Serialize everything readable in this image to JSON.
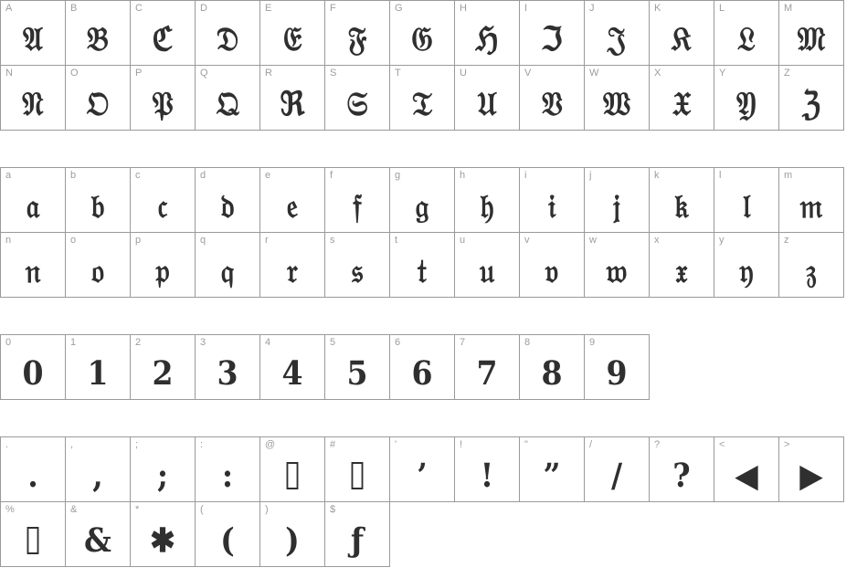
{
  "page": {
    "kind": "font-character-map-specimen",
    "background_color": "#ffffff",
    "cell_border_color": "#9a9a9a",
    "label_color": "#9d9d9d",
    "glyph_color": "#2f2f2f",
    "cell_size_px": 72
  },
  "sections": [
    {
      "id": "uppercase",
      "name": "uppercase-letters",
      "rows": [
        {
          "cells": [
            {
              "label": "A",
              "glyph": "𝔄",
              "missing": false
            },
            {
              "label": "B",
              "glyph": "𝔅",
              "missing": false
            },
            {
              "label": "C",
              "glyph": "ℭ",
              "missing": false
            },
            {
              "label": "D",
              "glyph": "𝔇",
              "missing": false
            },
            {
              "label": "E",
              "glyph": "𝔈",
              "missing": false
            },
            {
              "label": "F",
              "glyph": "𝔉",
              "missing": false
            },
            {
              "label": "G",
              "glyph": "𝔊",
              "missing": false
            },
            {
              "label": "H",
              "glyph": "ℌ",
              "missing": false
            },
            {
              "label": "I",
              "glyph": "ℑ",
              "missing": false
            },
            {
              "label": "J",
              "glyph": "𝔍",
              "missing": false
            },
            {
              "label": "K",
              "glyph": "𝔎",
              "missing": false
            },
            {
              "label": "L",
              "glyph": "𝔏",
              "missing": false
            },
            {
              "label": "M",
              "glyph": "𝔐",
              "missing": false
            }
          ]
        },
        {
          "cells": [
            {
              "label": "N",
              "glyph": "𝔑",
              "missing": false
            },
            {
              "label": "O",
              "glyph": "𝔒",
              "missing": false
            },
            {
              "label": "P",
              "glyph": "𝔓",
              "missing": false
            },
            {
              "label": "Q",
              "glyph": "𝔔",
              "missing": false
            },
            {
              "label": "R",
              "glyph": "ℜ",
              "missing": false
            },
            {
              "label": "S",
              "glyph": "𝔖",
              "missing": false
            },
            {
              "label": "T",
              "glyph": "𝔗",
              "missing": false
            },
            {
              "label": "U",
              "glyph": "𝔘",
              "missing": false
            },
            {
              "label": "V",
              "glyph": "𝔙",
              "missing": false
            },
            {
              "label": "W",
              "glyph": "𝔚",
              "missing": false
            },
            {
              "label": "X",
              "glyph": "𝔛",
              "missing": false
            },
            {
              "label": "Y",
              "glyph": "𝔜",
              "missing": false
            },
            {
              "label": "Z",
              "glyph": "ℨ",
              "missing": false
            }
          ]
        }
      ]
    },
    {
      "id": "lowercase",
      "name": "lowercase-letters",
      "rows": [
        {
          "cells": [
            {
              "label": "a",
              "glyph": "𝔞",
              "missing": false
            },
            {
              "label": "b",
              "glyph": "𝔟",
              "missing": false
            },
            {
              "label": "c",
              "glyph": "𝔠",
              "missing": false
            },
            {
              "label": "d",
              "glyph": "𝔡",
              "missing": false
            },
            {
              "label": "e",
              "glyph": "𝔢",
              "missing": false
            },
            {
              "label": "f",
              "glyph": "𝔣",
              "missing": false
            },
            {
              "label": "g",
              "glyph": "𝔤",
              "missing": false
            },
            {
              "label": "h",
              "glyph": "𝔥",
              "missing": false
            },
            {
              "label": "i",
              "glyph": "𝔦",
              "missing": false
            },
            {
              "label": "j",
              "glyph": "𝔧",
              "missing": false
            },
            {
              "label": "k",
              "glyph": "𝔨",
              "missing": false
            },
            {
              "label": "l",
              "glyph": "𝔩",
              "missing": false
            },
            {
              "label": "m",
              "glyph": "𝔪",
              "missing": false
            }
          ]
        },
        {
          "cells": [
            {
              "label": "n",
              "glyph": "𝔫",
              "missing": false
            },
            {
              "label": "o",
              "glyph": "𝔬",
              "missing": false
            },
            {
              "label": "p",
              "glyph": "𝔭",
              "missing": false
            },
            {
              "label": "q",
              "glyph": "𝔮",
              "missing": false
            },
            {
              "label": "r",
              "glyph": "𝔯",
              "missing": false
            },
            {
              "label": "s",
              "glyph": "𝔰",
              "missing": false
            },
            {
              "label": "t",
              "glyph": "𝔱",
              "missing": false
            },
            {
              "label": "u",
              "glyph": "𝔲",
              "missing": false
            },
            {
              "label": "v",
              "glyph": "𝔳",
              "missing": false
            },
            {
              "label": "w",
              "glyph": "𝔴",
              "missing": false
            },
            {
              "label": "x",
              "glyph": "𝔵",
              "missing": false
            },
            {
              "label": "y",
              "glyph": "𝔶",
              "missing": false
            },
            {
              "label": "z",
              "glyph": "𝔷",
              "missing": false
            }
          ]
        }
      ]
    },
    {
      "id": "digits",
      "name": "digits",
      "rows": [
        {
          "cells": [
            {
              "label": "0",
              "glyph": "0",
              "missing": false
            },
            {
              "label": "1",
              "glyph": "1",
              "missing": false
            },
            {
              "label": "2",
              "glyph": "2",
              "missing": false
            },
            {
              "label": "3",
              "glyph": "3",
              "missing": false
            },
            {
              "label": "4",
              "glyph": "4",
              "missing": false
            },
            {
              "label": "5",
              "glyph": "5",
              "missing": false
            },
            {
              "label": "6",
              "glyph": "6",
              "missing": false
            },
            {
              "label": "7",
              "glyph": "7",
              "missing": false
            },
            {
              "label": "8",
              "glyph": "8",
              "missing": false
            },
            {
              "label": "9",
              "glyph": "9",
              "missing": false
            }
          ]
        }
      ]
    },
    {
      "id": "punctuation",
      "name": "punctuation-and-symbols",
      "rows": [
        {
          "cells": [
            {
              "label": ".",
              "glyph": ".",
              "missing": false
            },
            {
              "label": ",",
              "glyph": ",",
              "missing": false
            },
            {
              "label": ";",
              "glyph": ";",
              "missing": false
            },
            {
              "label": ":",
              "glyph": ":",
              "missing": false
            },
            {
              "label": "@",
              "glyph": "@",
              "missing": true
            },
            {
              "label": "#",
              "glyph": "#",
              "missing": true
            },
            {
              "label": "'",
              "glyph": "’",
              "missing": false
            },
            {
              "label": "!",
              "glyph": "!",
              "missing": false
            },
            {
              "label": "\"",
              "glyph": "”",
              "missing": false
            },
            {
              "label": "/",
              "glyph": "/",
              "missing": false
            },
            {
              "label": "?",
              "glyph": "?",
              "missing": false
            },
            {
              "label": "<",
              "glyph": "◀",
              "missing": false
            },
            {
              "label": ">",
              "glyph": "▶",
              "missing": false
            }
          ]
        },
        {
          "cells": [
            {
              "label": "%",
              "glyph": "%",
              "missing": true
            },
            {
              "label": "&",
              "glyph": "&",
              "missing": false
            },
            {
              "label": "*",
              "glyph": "✱",
              "missing": false
            },
            {
              "label": "(",
              "glyph": "(",
              "missing": false
            },
            {
              "label": ")",
              "glyph": ")",
              "missing": false
            },
            {
              "label": "$",
              "glyph": "ƒ",
              "missing": false
            }
          ]
        }
      ]
    }
  ]
}
